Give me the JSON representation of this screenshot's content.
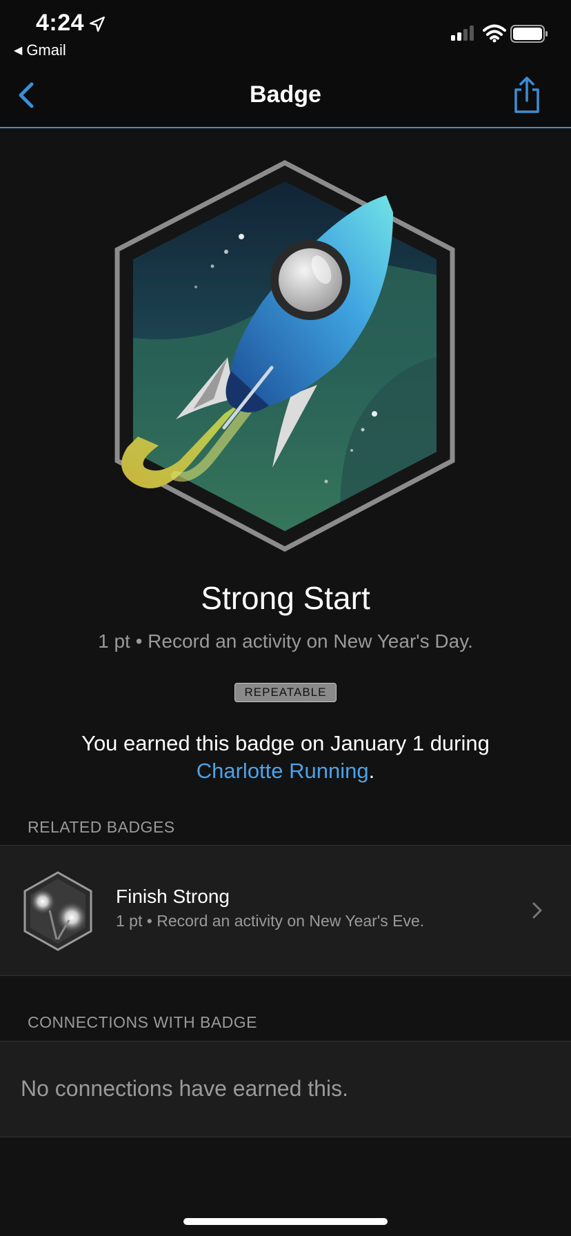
{
  "status_bar": {
    "time": "4:24",
    "back_app_label": "Gmail",
    "icons": [
      "location-arrow-icon",
      "cellular-signal-icon",
      "wifi-icon",
      "battery-icon"
    ]
  },
  "nav": {
    "title": "Badge",
    "back_icon": "chevron-left-icon",
    "share_icon": "share-icon",
    "accent_color": "#3b8fd6"
  },
  "badge": {
    "name": "Strong Start",
    "points": "1 pt",
    "separator": "•",
    "description": "Record an activity on New Year's Day.",
    "tag": "REPEATABLE",
    "earned_prefix": "You earned this badge on January 1 during",
    "earned_link": "Charlotte Running",
    "earned_suffix": ".",
    "art_icon": "rocket-badge-icon"
  },
  "related_badges": {
    "header": "RELATED BADGES",
    "items": [
      {
        "title": "Finish Strong",
        "points": "1 pt",
        "description": "Record an activity on New Year's Eve.",
        "icon": "fireworks-badge-icon"
      }
    ]
  },
  "connections": {
    "header": "CONNECTIONS WITH BADGE",
    "empty_text": "No connections have earned this."
  },
  "colors": {
    "background": "#121212",
    "link": "#4da3e8",
    "muted_text": "#9a9a9a"
  }
}
